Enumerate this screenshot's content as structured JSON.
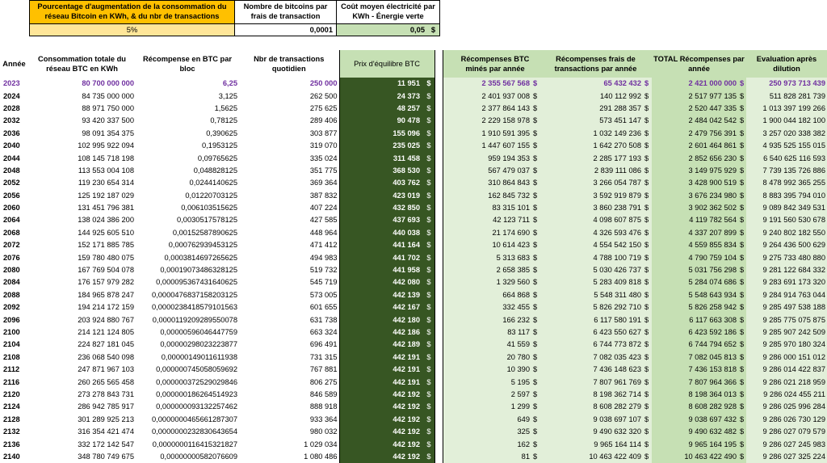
{
  "params": {
    "growth_label": "Pourcentage d'augmentation de la consommation du réseau Bitcoin en KWh, & du nbr de transactions",
    "growth_value": "5%",
    "fee_label": "Nombre de bitcoins par frais de transaction",
    "fee_value": "0,0001",
    "cost_label": "Coût moyen électricité par KWh - Énergie verte",
    "cost_value": "0,05",
    "cost_unit": "$"
  },
  "table": {
    "currency": "$",
    "headers": [
      "Année",
      "Consommation totale du réseau BTC en KWh",
      "Récompense en BTC par bloc",
      "Nbr de transactions quotidien",
      "Prix d'équilibre BTC",
      "Récompenses BTC minés par année",
      "Récompenses frais de transactions par année",
      "TOTAL Récompenses par année",
      "Evaluation après dilution"
    ],
    "rows": [
      [
        "2023",
        "80 700 000 000",
        "6,25",
        "250 000",
        "11 951",
        "2 355 567 568",
        "65 432 432",
        "2 421 000 000",
        "250 973 713 439"
      ],
      [
        "2024",
        "84 735 000 000",
        "3,125",
        "262 500",
        "24 373",
        "2 401 937 008",
        "140 112 992",
        "2 517 977 135",
        "511 828 281 739"
      ],
      [
        "2028",
        "88 971 750 000",
        "1,5625",
        "275 625",
        "48 257",
        "2 377 864 143",
        "291 288 357",
        "2 520 447 335",
        "1 013 397 199 266"
      ],
      [
        "2032",
        "93 420 337 500",
        "0,78125",
        "289 406",
        "90 478",
        "2 229 158 978",
        "573 451 147",
        "2 484 042 542",
        "1 900 044 182 100"
      ],
      [
        "2036",
        "98 091 354 375",
        "0,390625",
        "303 877",
        "155 096",
        "1 910 591 395",
        "1 032 149 236",
        "2 479 756 391",
        "3 257 020 338 382"
      ],
      [
        "2040",
        "102 995 922 094",
        "0,1953125",
        "319 070",
        "235 025",
        "1 447 607 155",
        "1 642 270 508",
        "2 601 464 861",
        "4 935 525 155 015"
      ],
      [
        "2044",
        "108 145 718 198",
        "0,09765625",
        "335 024",
        "311 458",
        "959 194 353",
        "2 285 177 193",
        "2 852 656 230",
        "6 540 625 116 593"
      ],
      [
        "2048",
        "113 553 004 108",
        "0,048828125",
        "351 775",
        "368 530",
        "567 479 037",
        "2 839 111 086",
        "3 149 975 929",
        "7 739 135 726 886"
      ],
      [
        "2052",
        "119 230 654 314",
        "0,0244140625",
        "369 364",
        "403 762",
        "310 864 843",
        "3 266 054 787",
        "3 428 900 519",
        "8 478 992 365 255"
      ],
      [
        "2056",
        "125 192 187 029",
        "0,01220703125",
        "387 832",
        "423 019",
        "162 845 732",
        "3 592 919 879",
        "3 676 234 980",
        "8 883 395 794 010"
      ],
      [
        "2060",
        "131 451 796 381",
        "0,006103515625",
        "407 224",
        "432 850",
        "83 315 101",
        "3 860 238 791",
        "3 902 362 502",
        "9 089 842 349 531"
      ],
      [
        "2064",
        "138 024 386 200",
        "0,0030517578125",
        "427 585",
        "437 693",
        "42 123 711",
        "4 098 607 875",
        "4 119 782 564",
        "9 191 560 530 678"
      ],
      [
        "2068",
        "144 925 605 510",
        "0,00152587890625",
        "448 964",
        "440 038",
        "21 174 690",
        "4 326 593 476",
        "4 337 207 899",
        "9 240 802 182 550"
      ],
      [
        "2072",
        "152 171 885 785",
        "0,000762939453125",
        "471 412",
        "441 164",
        "10 614 423",
        "4 554 542 150",
        "4 559 855 834",
        "9 264 436 500 629"
      ],
      [
        "2076",
        "159 780 480 075",
        "0,0003814697265625",
        "494 983",
        "441 702",
        "5 313 683",
        "4 788 100 719",
        "4 790 759 104",
        "9 275 733 480 880"
      ],
      [
        "2080",
        "167 769 504 078",
        "0,00019073486328125",
        "519 732",
        "441 958",
        "2 658 385",
        "5 030 426 737",
        "5 031 756 298",
        "9 281 122 684 332"
      ],
      [
        "2084",
        "176 157 979 282",
        "0,000095367431640625",
        "545 719",
        "442 080",
        "1 329 560",
        "5 283 409 818",
        "5 284 074 686",
        "9 283 691 173 320"
      ],
      [
        "2088",
        "184 965 878 247",
        "0,0000476837158203125",
        "573 005",
        "442 139",
        "664 868",
        "5 548 311 480",
        "5 548 643 934",
        "9 284 914 763 044"
      ],
      [
        "2092",
        "194 214 172 159",
        "0,0000238418579101563",
        "601 655",
        "442 167",
        "332 455",
        "5 826 292 710",
        "5 826 258 942",
        "9 285 497 538 188"
      ],
      [
        "2096",
        "203 924 880 767",
        "0,0000119209289550078",
        "631 738",
        "442 180",
        "166 232",
        "6 117 580 191",
        "6 117 663 308",
        "9 285 775 075 875"
      ],
      [
        "2100",
        "214 121 124 805",
        "0,00000596046447759",
        "663 324",
        "442 186",
        "83 117",
        "6 423 550 627",
        "6 423 592 186",
        "9 285 907 242 509"
      ],
      [
        "2104",
        "224 827 181 045",
        "0,00000298023223877",
        "696 491",
        "442 189",
        "41 559",
        "6 744 773 872",
        "6 744 794 652",
        "9 285 970 180 324"
      ],
      [
        "2108",
        "236 068 540 098",
        "0,00000149011611938",
        "731 315",
        "442 191",
        "20 780",
        "7 082 035 423",
        "7 082 045 813",
        "9 286 000 151 012"
      ],
      [
        "2112",
        "247 871 967 103",
        "0,000000745058059692",
        "767 881",
        "442 191",
        "10 390",
        "7 436 148 623",
        "7 436 153 818",
        "9 286 014 422 837"
      ],
      [
        "2116",
        "260 265 565 458",
        "0,000000372529029846",
        "806 275",
        "442 191",
        "5 195",
        "7 807 961 769",
        "7 807 964 366",
        "9 286 021 218 959"
      ],
      [
        "2120",
        "273 278 843 731",
        "0,000000186264514923",
        "846 589",
        "442 192",
        "2 597",
        "8 198 362 714",
        "8 198 364 013",
        "9 286 024 455 211"
      ],
      [
        "2124",
        "286 942 785 917",
        "0,000000093132257462",
        "888 918",
        "442 192",
        "1 299",
        "8 608 282 279",
        "8 608 282 928",
        "9 286 025 996 284"
      ],
      [
        "2128",
        "301 289 925 213",
        "0,0000000465661287307",
        "933 364",
        "442 192",
        "649",
        "9 038 697 107",
        "9 038 697 432",
        "9 286 026 730 129"
      ],
      [
        "2132",
        "316 354 421 474",
        "0,0000000232830643654",
        "980 032",
        "442 192",
        "325",
        "9 490 632 320",
        "9 490 632 482",
        "9 286 027 079 579"
      ],
      [
        "2136",
        "332 172 142 547",
        "0,0000000116415321827",
        "1 029 034",
        "442 192",
        "162",
        "9 965 164 114",
        "9 965 164 195",
        "9 286 027 245 983"
      ],
      [
        "2140",
        "348 780 749 675",
        "0,00000000582076609",
        "1 080 486",
        "442 192",
        "81",
        "10 463 422 409",
        "10 463 422 490",
        "9 286 027 325 224"
      ]
    ]
  }
}
